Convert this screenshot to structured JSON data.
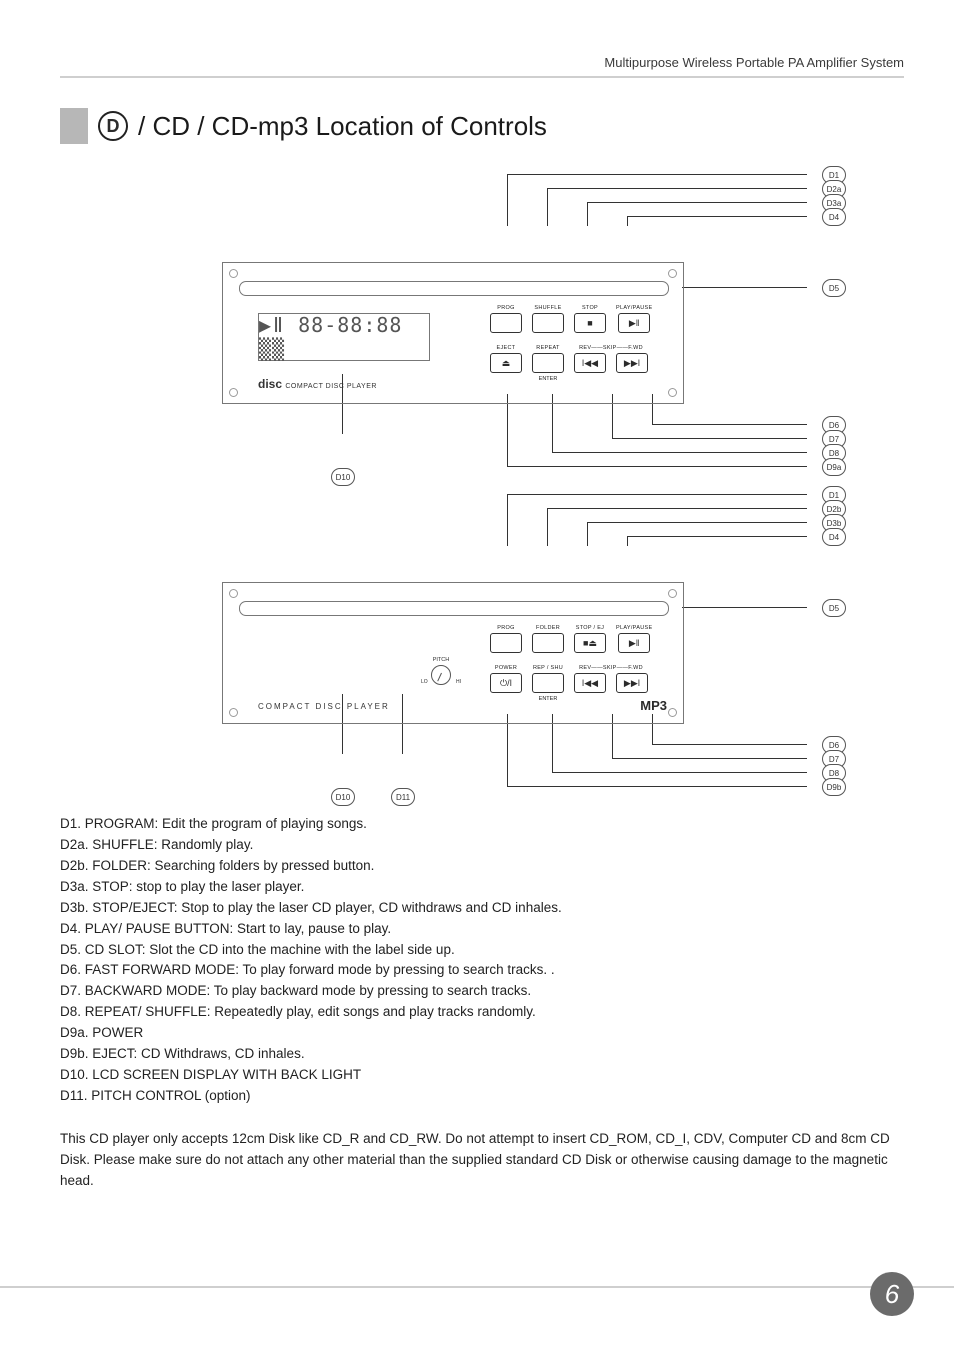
{
  "header": "Multipurpose Wireless Portable PA Amplifier System",
  "section_letter": "D",
  "section_title": "/ CD / CD-mp3 Location of Controls",
  "panel1": {
    "seg": "▶ǁ 88‑88:88 ▒▒",
    "brand": "disc",
    "brand_sub": "COMPACT DISC PLAYER",
    "rowA": [
      {
        "label": "PROG",
        "icon": ""
      },
      {
        "label": "SHUFFLE",
        "icon": ""
      },
      {
        "label": "STOP",
        "icon": "■"
      },
      {
        "label": "PLAY/PAUSE",
        "icon": "▶ǁ"
      }
    ],
    "rowB": [
      {
        "label": "EJECT",
        "icon": "⏏"
      },
      {
        "label": "REPEAT",
        "icon": "",
        "sublabel": "ENTER"
      },
      {
        "label": "REV——SKIP——F.WD",
        "icon": "ǀ◀◀",
        "icon2": "▶▶ǀ",
        "span2": true
      }
    ],
    "callouts_right": [
      "D1",
      "D2a",
      "D3a",
      "D4",
      "D5",
      "D6",
      "D7",
      "D8",
      "D9a"
    ],
    "callouts_bottom": [
      "D10"
    ]
  },
  "panel2": {
    "brand": "COMPACT  DISC  PLAYER",
    "pitch": {
      "label": "PITCH",
      "lo": "LO",
      "hi": "HI"
    },
    "rowA": [
      {
        "label": "PROG",
        "icon": ""
      },
      {
        "label": "FOLDER",
        "icon": ""
      },
      {
        "label": "STOP / EJ",
        "icon": "■⏏"
      },
      {
        "label": "PLAY/PAUSE",
        "icon": "▶ǁ"
      }
    ],
    "rowB": [
      {
        "label": "POWER",
        "icon": "⏻/ǀ"
      },
      {
        "label": "REP / SHU",
        "icon": "",
        "sublabel": "ENTER"
      },
      {
        "label": "REV——SKIP——F.WD",
        "icon": "ǀ◀◀",
        "icon2": "▶▶ǀ",
        "span2": true
      }
    ],
    "mp3_badge": "MP3",
    "callouts_right": [
      "D1",
      "D2b",
      "D3b",
      "D4",
      "D5",
      "D6",
      "D7",
      "D8",
      "D9b"
    ],
    "callouts_bottom": [
      "D10",
      "D11"
    ]
  },
  "list": [
    "D1. PROGRAM: Edit the program of playing songs.",
    "D2a. SHUFFLE: Randomly play.",
    "D2b. FOLDER: Searching folders by pressed button.",
    "D3a. STOP: stop to play the laser player.",
    "D3b. STOP/EJECT: Stop to play the laser CD player, CD withdraws and CD inhales.",
    "D4. PLAY/ PAUSE BUTTON: Start to lay, pause to play.",
    "D5. CD SLOT: Slot the CD into the machine with the label side up.",
    "D6. FAST FORWARD MODE: To play forward mode by pressing to search tracks. .",
    "D7. BACKWARD MODE: To play backward mode by pressing to search tracks.",
    "D8. REPEAT/ SHUFFLE: Repeatedly play, edit songs and play tracks randomly.",
    "D9a. POWER",
    "D9b. EJECT: CD Withdraws, CD inhales.",
    "D10. LCD SCREEN DISPLAY WITH BACK LIGHT",
    "D11. PITCH CONTROL (option)"
  ],
  "note": "This CD player only accepts 12cm Disk like CD_R and CD_RW. Do not attempt to insert CD_ROM, CD_I, CDV, Computer CD and 8cm CD Disk. Please make sure do not attach any other material than the supplied standard CD Disk or otherwise causing damage to the magnetic head.",
  "page_number": "6"
}
